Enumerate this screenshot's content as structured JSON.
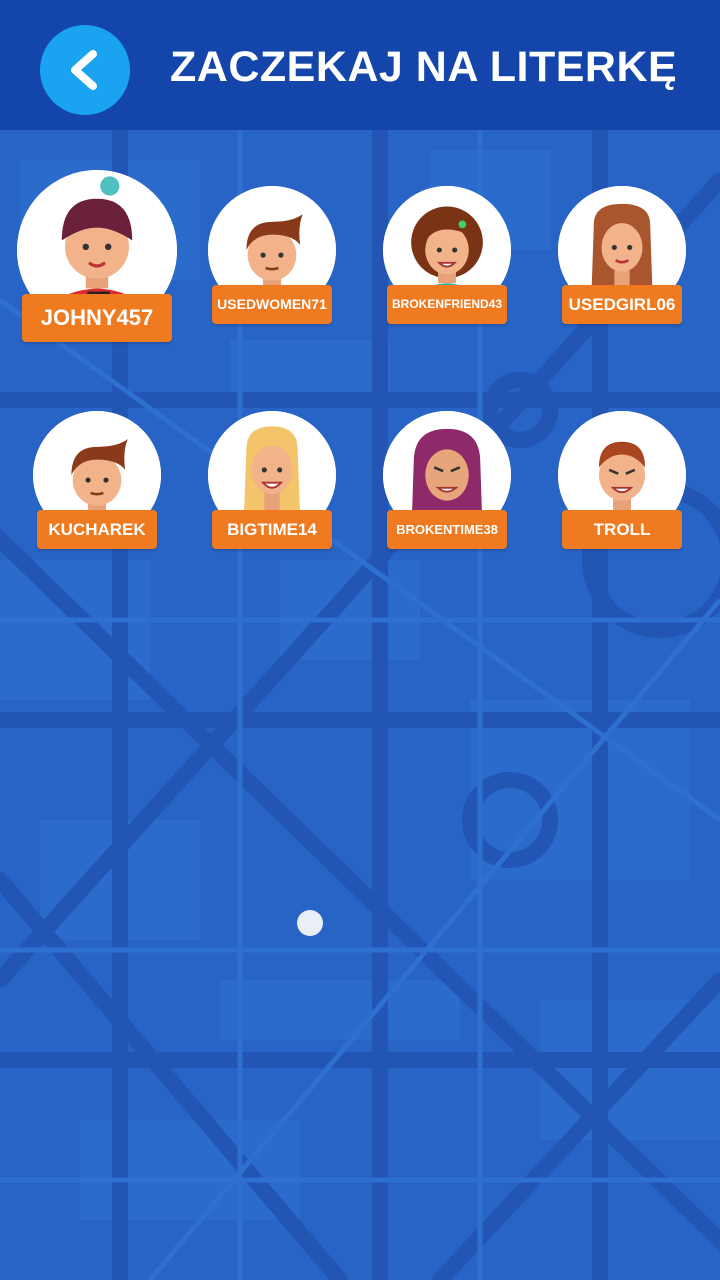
{
  "header": {
    "title": "ZACZEKAJ NA LITERKĘ",
    "back_icon": "chevron-left-icon"
  },
  "colors": {
    "background": "#2864c6",
    "header": "#1445ab",
    "back_button": "#1aa3f0",
    "name_tag": "#f07a1f"
  },
  "players": [
    {
      "name": "JOHNY457",
      "avatar": "boy-beanie-avatar"
    },
    {
      "name": "USEDWOMEN71",
      "avatar": "boy-red-hair-avatar"
    },
    {
      "name": "BROKENFRIEND43",
      "avatar": "woman-curly-hair-avatar"
    },
    {
      "name": "USEDGIRL06",
      "avatar": "girl-long-hair-avatar"
    },
    {
      "name": "KUCHAREK",
      "avatar": "boy-red-hair-avatar"
    },
    {
      "name": "BIGTIME14",
      "avatar": "blonde-girl-avatar"
    },
    {
      "name": "BROKENTIME38",
      "avatar": "hijab-woman-avatar"
    },
    {
      "name": "TROLL",
      "avatar": "man-bowtie-avatar"
    }
  ],
  "loading_indicator": "loading-dot"
}
